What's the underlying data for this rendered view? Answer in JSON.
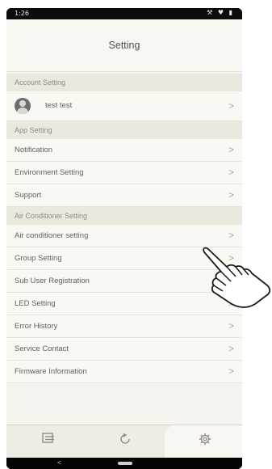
{
  "status_bar": {
    "time": "1:26",
    "icons": "⚒ ♥ ▮"
  },
  "header": {
    "title": "Setting"
  },
  "account_section": {
    "label": "Account Setting",
    "user_name": "test test"
  },
  "app_section": {
    "label": "App Setting",
    "items": [
      "Notification",
      "Environment Setting",
      "Support"
    ]
  },
  "ac_section": {
    "label": "Air Conditioner Setting",
    "items": [
      "Air conditioner setting",
      "Group Setting",
      "Sub User Registration",
      "LED Setting",
      "Error History",
      "Service Contact",
      "Firmware Information"
    ]
  },
  "chevron": ">",
  "navbar": {
    "back": "<"
  },
  "tabs": [
    "list-icon",
    "history-icon",
    "gear-icon"
  ]
}
